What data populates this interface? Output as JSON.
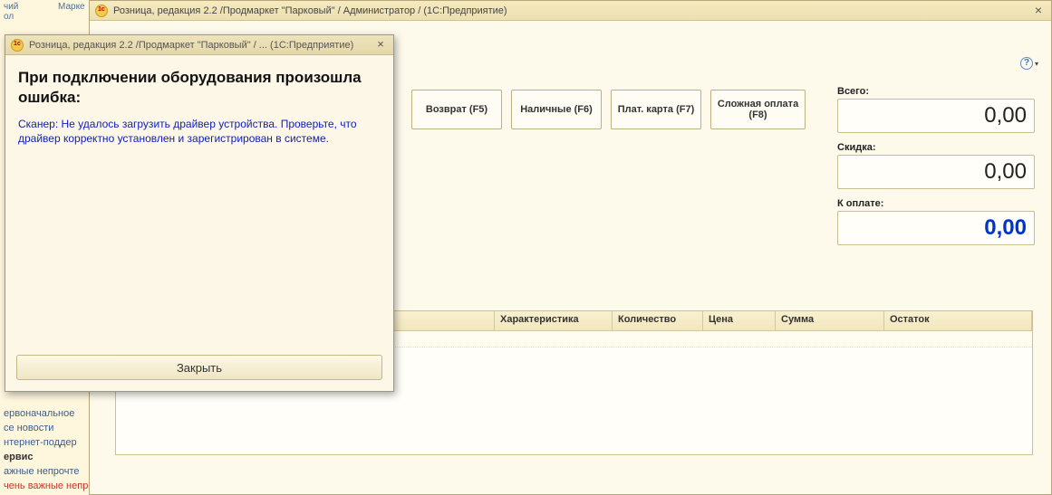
{
  "background": {
    "tab1": "чий",
    "tab1b": "ол",
    "tab2": "Марке",
    "links": {
      "l1": "ервоначальное",
      "l2": "се новости",
      "l3": "нтернет-поддер",
      "hdr": "ервис",
      "l4": "ажные непрочте",
      "l5": "чень важные непро..."
    }
  },
  "mainwin": {
    "title": "Розница, редакция 2.2 /Продмаркет \"Парковый\" / Администратор /  (1С:Предприятие)",
    "buttons": {
      "b1": "Возврат (F5)",
      "b2": "Наличные (F6)",
      "b3": "Плат. карта (F7)",
      "b4": "Сложная оплата (F8)"
    },
    "totals": {
      "lab1": "Всего:",
      "val1": "0,00",
      "lab2": "Скидка:",
      "val2": "0,00",
      "lab3": "К оплате:",
      "val3": "0,00"
    },
    "grid": {
      "h1": "",
      "h2": "Характеристика",
      "h3": "Количество",
      "h4": "Цена",
      "h5": "Сумма",
      "h6": "Остаток"
    }
  },
  "modal": {
    "title": "Розница, редакция 2.2 /Продмаркет \"Парковый\" / ...  (1С:Предприятие)",
    "heading": "При подключении оборудования произошла ошибка:",
    "text": "Сканер: Не удалось загрузить драйвер устройства. Проверьте, что драйвер корректно установлен и зарегистрирован в системе.",
    "close_label": "Закрыть"
  }
}
